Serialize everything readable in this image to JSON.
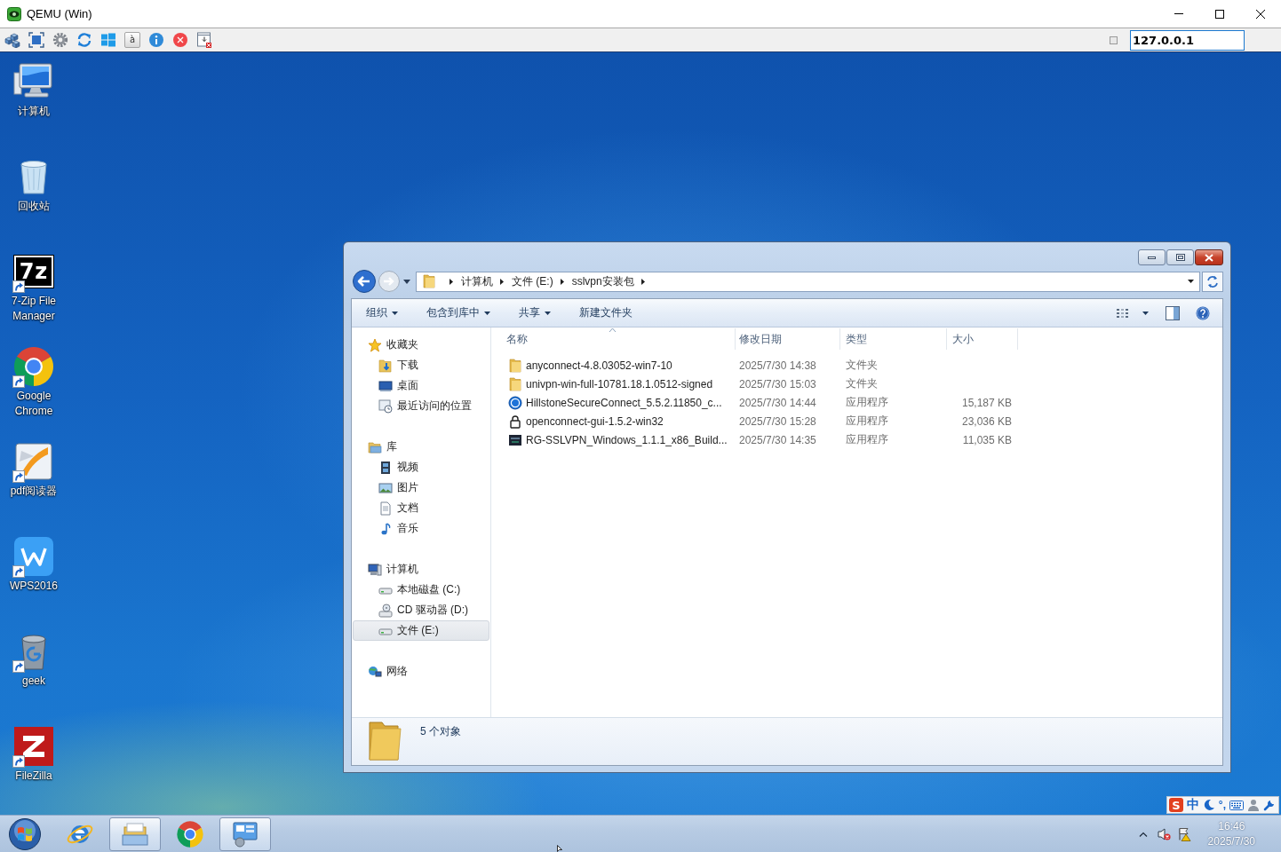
{
  "window": {
    "title": "QEMU (Win)"
  },
  "toolbar": {
    "buttons": [
      {
        "kind": "cubes"
      },
      {
        "kind": "fullscreen"
      },
      {
        "kind": "settings"
      },
      {
        "kind": "refresh"
      },
      {
        "kind": "tiles"
      },
      {
        "kind": "key",
        "label": "à"
      },
      {
        "kind": "info"
      },
      {
        "kind": "stop"
      },
      {
        "kind": "window-download"
      }
    ],
    "sync_checkbox": {
      "checked": false
    },
    "host": "127.0.0.1"
  },
  "desktop": {
    "icons": [
      {
        "kind": "computer",
        "label": "计算机",
        "shortcut": false
      },
      {
        "kind": "recycle-bin",
        "label": "回收站",
        "shortcut": false
      },
      {
        "kind": "archiver",
        "glyph": "7z",
        "label": "7-Zip File Manager",
        "shortcut": true
      },
      {
        "kind": "browser",
        "label": "Google Chrome",
        "shortcut": true
      },
      {
        "kind": "pdf",
        "label": "pdf阅读器",
        "shortcut": true
      },
      {
        "kind": "office",
        "label": "WPS2016",
        "shortcut": true
      },
      {
        "kind": "uninstaller",
        "label": "geek",
        "shortcut": true
      },
      {
        "kind": "ftp",
        "label": "FileZilla",
        "shortcut": true
      }
    ]
  },
  "explorer": {
    "breadcrumb": [
      "计算机",
      "文件 (E:)",
      "sslvpn安装包"
    ],
    "commands": [
      {
        "label": "组织",
        "dropdown": true
      },
      {
        "label": "包含到库中",
        "dropdown": true
      },
      {
        "label": "共享",
        "dropdown": true
      },
      {
        "label": "新建文件夹",
        "dropdown": false
      }
    ],
    "navigation": [
      {
        "label": "收藏夹",
        "kind": "favorites",
        "selected": false,
        "children": [
          {
            "label": "下载",
            "kind": "downloads",
            "selected": false
          },
          {
            "label": "桌面",
            "kind": "desktop",
            "selected": false
          },
          {
            "label": "最近访问的位置",
            "kind": "recent",
            "selected": false
          }
        ]
      },
      {
        "label": "库",
        "kind": "libraries",
        "selected": false,
        "children": [
          {
            "label": "视频",
            "kind": "videos",
            "selected": false
          },
          {
            "label": "图片",
            "kind": "pictures",
            "selected": false
          },
          {
            "label": "文档",
            "kind": "documents",
            "selected": false
          },
          {
            "label": "音乐",
            "kind": "music",
            "selected": false
          }
        ]
      },
      {
        "label": "计算机",
        "kind": "computer",
        "selected": false,
        "children": [
          {
            "label": "本地磁盘 (C:)",
            "kind": "drive",
            "selected": false
          },
          {
            "label": "CD 驱动器 (D:)",
            "kind": "cd-drive",
            "selected": false
          },
          {
            "label": "文件 (E:)",
            "kind": "drive",
            "selected": true
          }
        ]
      },
      {
        "label": "网络",
        "kind": "network",
        "selected": false
      }
    ],
    "columns": [
      {
        "label": "名称",
        "sorted": true
      },
      {
        "label": "修改日期",
        "sorted": false
      },
      {
        "label": "类型",
        "sorted": false
      },
      {
        "label": "大小",
        "sorted": false
      }
    ],
    "files": [
      {
        "kind": "folder",
        "name": "anyconnect-4.8.03052-win7-10",
        "modified": "2025/7/30 14:38",
        "type": "文件夹"
      },
      {
        "kind": "folder",
        "name": "univpn-win-full-10781.18.1.0512-signed",
        "modified": "2025/7/30 15:03",
        "type": "文件夹"
      },
      {
        "kind": "badge-app",
        "name": "HillstoneSecureConnect_5.5.2.11850_c...",
        "modified": "2025/7/30 14:44",
        "type": "应用程序",
        "size": "15,187 KB"
      },
      {
        "kind": "lock-app",
        "name": "openconnect-gui-1.5.2-win32",
        "modified": "2025/7/30 15:28",
        "type": "应用程序",
        "size": "23,036 KB"
      },
      {
        "kind": "dark-app",
        "name": "RG-SSLVPN_Windows_1.1.1_x86_Build...",
        "modified": "2025/7/30 14:35",
        "type": "应用程序",
        "size": "11,035 KB"
      }
    ],
    "status": "5 个对象"
  },
  "ime": {
    "logo": "S",
    "mode": "中",
    "punctuation": "°,"
  },
  "taskbar": {
    "apps": [
      {
        "kind": "ie",
        "running": false
      },
      {
        "kind": "explorer",
        "running": true
      },
      {
        "kind": "chrome",
        "running": false
      },
      {
        "kind": "remote",
        "running": true
      }
    ],
    "tray": {
      "muted": true
    },
    "time": "16:46",
    "date": "2025/7/30"
  }
}
